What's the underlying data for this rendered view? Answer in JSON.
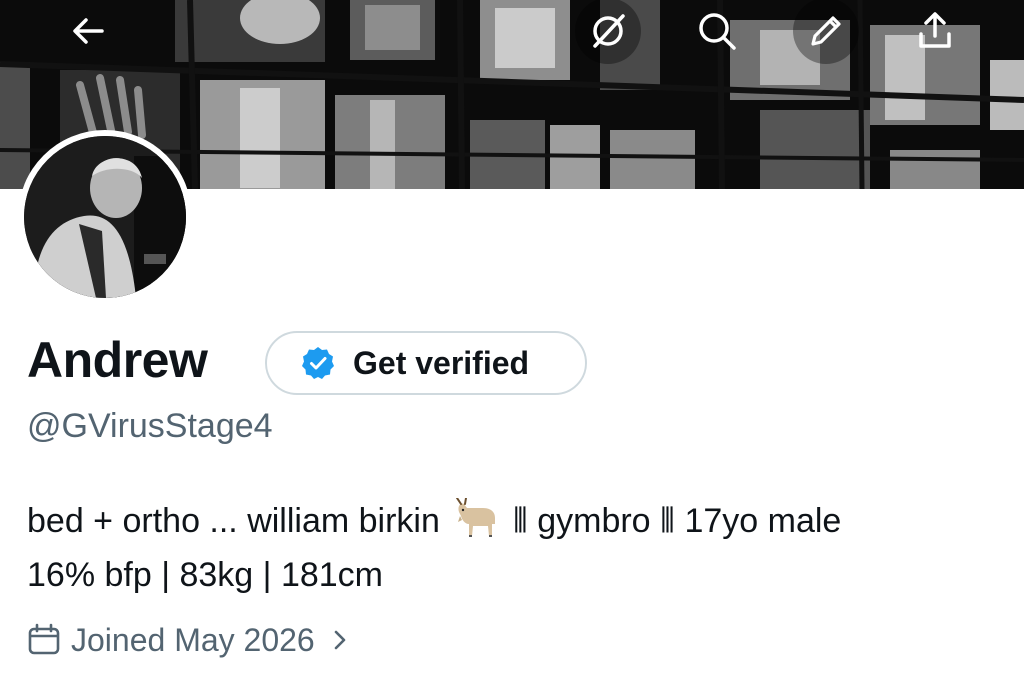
{
  "profile": {
    "display_name": "Andrew",
    "handle": "@GVirusStage4",
    "get_verified_label": "Get verified",
    "bio_line1_a": "bed + ortho ... william birkin",
    "bio_line1_b": "⦀ gymbro ⦀ 17yo male",
    "bio_line2": "16% bfp | 83kg | 181cm",
    "joined": "Joined May 2026"
  },
  "topbar": {
    "icons": [
      "back-arrow-icon",
      "grok-icon",
      "search-icon",
      "edit-pencil-icon",
      "share-icon"
    ]
  },
  "colors": {
    "verified_blue": "#1d9bf0",
    "secondary_text": "#536471",
    "border": "#cfd9de"
  }
}
